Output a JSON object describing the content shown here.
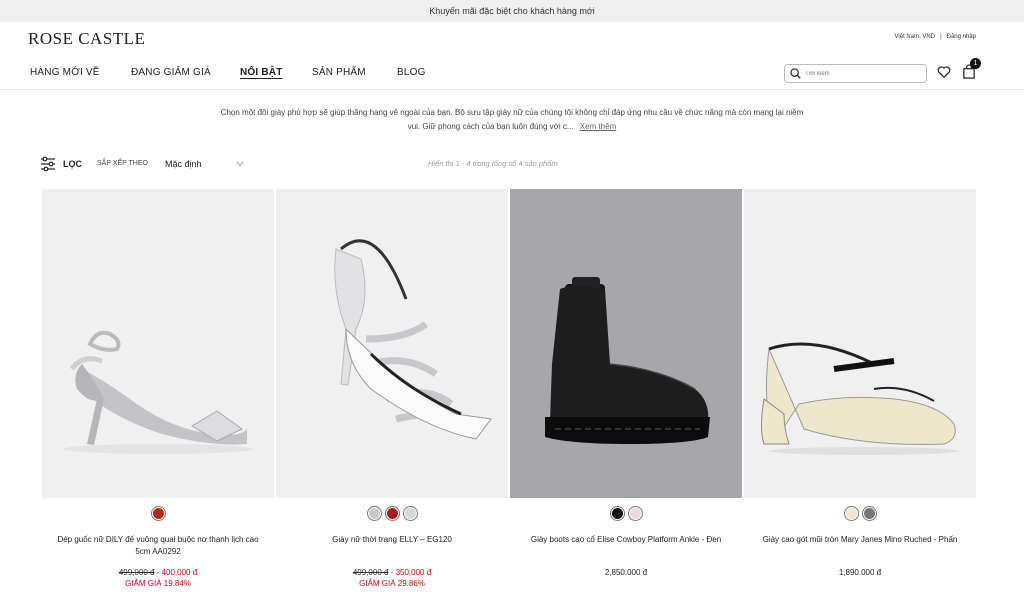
{
  "promo": "Khuyến mãi đặc biệt cho khách hàng mới",
  "brand": "ROSE CASTLE",
  "locale": {
    "region": "Việt Nam, VND",
    "separator": "|",
    "login": "Đăng nhập"
  },
  "nav": [
    "HÀNG MỚI VỀ",
    "ĐANG GIẢM GIÁ",
    "NỔI BẬT",
    "SẢN PHẨM",
    "BLOG"
  ],
  "nav_active": "NỔI BẬT",
  "search": {
    "placeholder": "Tìm kiếm"
  },
  "cart_count": "1",
  "intro": {
    "text": "Chọn một đôi giày phù hợp sẽ giúp thăng hạng vẻ ngoài của bạn. Bộ sưu tập giày nữ của chúng tôi không chỉ đáp ứng nhu cầu về chức năng mà còn mang lại niềm vui. Giữ phong cách của bạn luôn đúng với c...",
    "more": "Xem thêm"
  },
  "toolbar": {
    "filter": "LỌC",
    "sort_label": "SẮP XẾP THEO",
    "sort_value": "Mặc định",
    "count": "Hiển thị 1 - 4 trong tổng số 4 sản phẩm"
  },
  "products": [
    {
      "name": "Dép guốc nữ DILY đế vuông quai buộc nơ thanh lịch cao 5cm AA0292",
      "old_price": "499,000 đ",
      "price": "400,000 đ",
      "discount": "GIẢM GIÁ 19.84%",
      "swatches": [
        "#b3261e"
      ]
    },
    {
      "name": "Giày nữ thời trang ELLY – EG120",
      "old_price": "499,000 đ",
      "price": "350,000 đ",
      "discount": "GIẢM GIÁ 29.86%",
      "swatches": [
        "#c9c9c9",
        "#a31f1f",
        "#d8d8d8"
      ]
    },
    {
      "name": "Giày boots cao cổ Elise Cowboy Platform Ankle - Đen",
      "price": "2,850.000 đ",
      "swatches": [
        "#111111",
        "#eadbdf"
      ]
    },
    {
      "name": "Giày cao gót mũi tròn Mary Janes Mino Ruched - Phấn",
      "price": "1,890.000 đ",
      "swatches": [
        "#efe8cf",
        "#777777"
      ]
    }
  ],
  "icons": [
    "search-icon",
    "heart-icon",
    "bag-icon",
    "filter-icon",
    "chevron-down-icon"
  ]
}
